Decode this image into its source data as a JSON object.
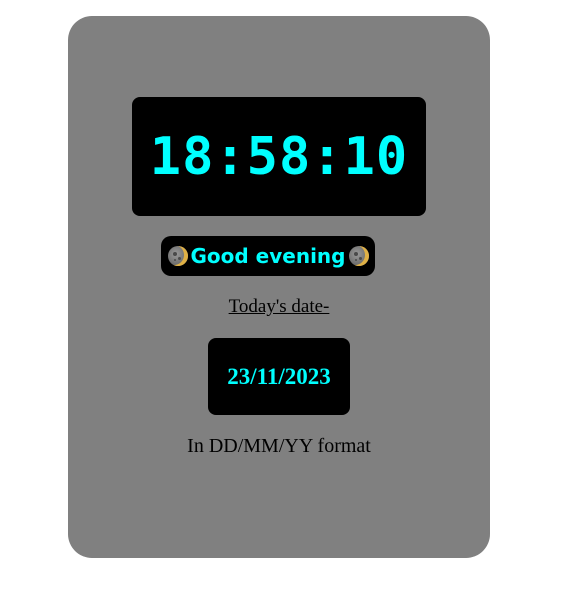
{
  "clock": {
    "time": "18:58:10"
  },
  "greeting": {
    "text": "Good evening",
    "left_icon": "moon-icon",
    "right_icon": "moon-icon"
  },
  "date": {
    "label": "Today's date-",
    "value": "23/11/2023",
    "format_note": "In DD/MM/YY format"
  },
  "colors": {
    "card_background": "#808080",
    "box_background": "#000000",
    "accent_text": "#00ffff",
    "page_background": "#ffffff"
  }
}
